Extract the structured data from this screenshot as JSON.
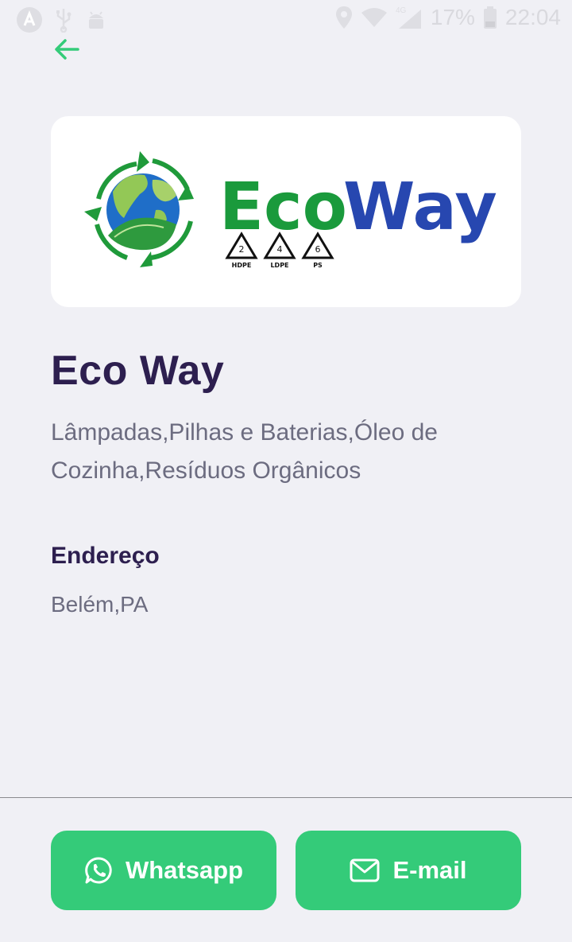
{
  "status_bar": {
    "battery_percent": "17%",
    "time": "22:04",
    "network": "4G"
  },
  "logo": {
    "brand_eco": "Eco",
    "brand_way": "Way",
    "recycle_codes": [
      {
        "number": "2",
        "label": "HDPE"
      },
      {
        "number": "4",
        "label": "LDPE"
      },
      {
        "number": "6",
        "label": "PS"
      }
    ]
  },
  "point": {
    "name": "Eco Way",
    "materials": "Lâmpadas,Pilhas e Baterias,Óleo de Cozinha,Resíduos Orgânicos",
    "address_heading": "Endereço",
    "address": "Belém,PA"
  },
  "actions": {
    "whatsapp_label": "Whatsapp",
    "email_label": "E-mail"
  },
  "colors": {
    "accent_green": "#34cb79",
    "title_purple": "#2d1f4f",
    "text_gray": "#6c6c80",
    "background": "#f0f0f5",
    "logo_green": "#1a9a3c",
    "logo_blue": "#2747b0"
  }
}
